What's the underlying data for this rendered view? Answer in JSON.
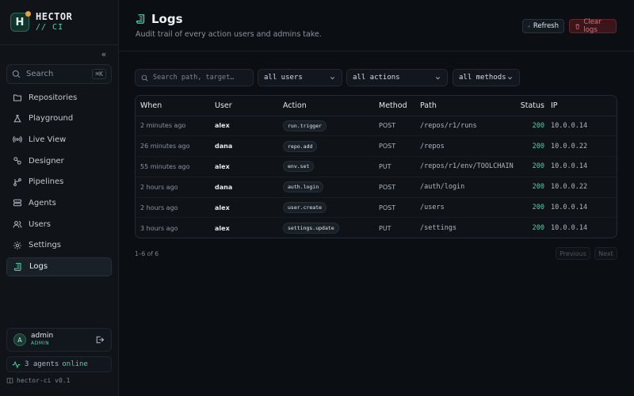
{
  "brand": {
    "logo_letter": "H",
    "name": "HECTOR",
    "sub": "// CI"
  },
  "sidebar": {
    "search": {
      "label": "Search",
      "shortcut": "⌘K"
    },
    "items": [
      {
        "label": "Repositories",
        "icon": "folder-icon"
      },
      {
        "label": "Playground",
        "icon": "flask-icon"
      },
      {
        "label": "Live View",
        "icon": "broadcast-icon"
      },
      {
        "label": "Designer",
        "icon": "designer-icon"
      },
      {
        "label": "Pipelines",
        "icon": "branch-icon"
      },
      {
        "label": "Agents",
        "icon": "server-icon"
      },
      {
        "label": "Users",
        "icon": "users-icon"
      },
      {
        "label": "Settings",
        "icon": "gear-icon"
      },
      {
        "label": "Logs",
        "icon": "scroll-icon",
        "active": true
      }
    ],
    "user": {
      "initial": "A",
      "name": "admin",
      "role": "ADMIN"
    },
    "agents": {
      "text": "3 agents",
      "status": "online"
    },
    "version": "hector-ci v0.1"
  },
  "header": {
    "title": "Logs",
    "subtitle": "Audit trail of every action users and admins take.",
    "refresh_label": "Refresh",
    "clear_label": "Clear logs"
  },
  "filters": {
    "search_placeholder": "Search path, target…",
    "users": "all users",
    "actions": "all actions",
    "methods": "all methods"
  },
  "table": {
    "columns": {
      "when": "When",
      "user": "User",
      "action": "Action",
      "method": "Method",
      "path": "Path",
      "status": "Status",
      "ip": "IP"
    },
    "rows": [
      {
        "when": "2 minutes ago",
        "user": "alex",
        "action": "run.trigger",
        "method": "POST",
        "path": "/repos/r1/runs",
        "status": "200",
        "ip": "10.0.0.14"
      },
      {
        "when": "26 minutes ago",
        "user": "dana",
        "action": "repo.add",
        "method": "POST",
        "path": "/repos",
        "status": "200",
        "ip": "10.0.0.22"
      },
      {
        "when": "55 minutes ago",
        "user": "alex",
        "action": "env.set",
        "method": "PUT",
        "path": "/repos/r1/env/TOOLCHAIN",
        "status": "200",
        "ip": "10.0.0.14"
      },
      {
        "when": "2 hours ago",
        "user": "dana",
        "action": "auth.login",
        "method": "POST",
        "path": "/auth/login",
        "status": "200",
        "ip": "10.0.0.22"
      },
      {
        "when": "2 hours ago",
        "user": "alex",
        "action": "user.create",
        "method": "POST",
        "path": "/users",
        "status": "200",
        "ip": "10.0.0.14"
      },
      {
        "when": "3 hours ago",
        "user": "alex",
        "action": "settings.update",
        "method": "PUT",
        "path": "/settings",
        "status": "200",
        "ip": "10.0.0.14"
      }
    ]
  },
  "pagination": {
    "info": "1–6 of 6",
    "previous": "Previous",
    "next": "Next"
  },
  "colors": {
    "accent": "#4fd1a5",
    "danger": "#ef6a6f",
    "background": "#0b0e12"
  }
}
